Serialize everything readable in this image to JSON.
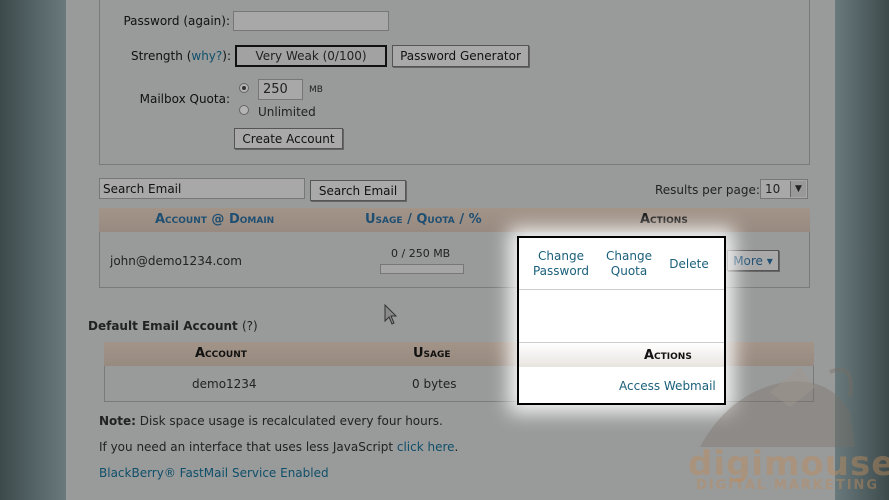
{
  "form": {
    "password_again_label": "Password (again):",
    "strength_label": "Strength",
    "strength_why": "why?",
    "strength_colon": "):",
    "strength_open": " (",
    "strength_value": "Very Weak (0/100)",
    "password_generator": "Password Generator",
    "mailbox_quota_label": "Mailbox Quota:",
    "quota_value": "250",
    "quota_unit": "MB",
    "unlimited_label": "Unlimited",
    "create_account": "Create Account"
  },
  "search": {
    "placeholder": "Search Email",
    "button": "Search Email",
    "results_label": "Results per page:",
    "results_value": "10"
  },
  "accounts_table": {
    "headers": {
      "account_domain": "Account @ Domain",
      "usage": "Usage",
      "quota": "Quota",
      "percent": "%",
      "slash": "/",
      "actions": "Actions"
    },
    "row": {
      "email": "john@demo1234.com",
      "usage": "0 / 250 MB",
      "usage_fraction": 0.0,
      "more": "More"
    }
  },
  "popup": {
    "change_password": "Change Password",
    "change_quota": "Change Quota",
    "delete": "Delete",
    "actions_header": "Actions",
    "access_webmail": "Access Webmail"
  },
  "default_account": {
    "title": "Default Email Account",
    "help": "(?)",
    "headers": {
      "account": "Account",
      "usage": "Usage"
    },
    "row": {
      "account": "demo1234",
      "usage": "0 bytes"
    }
  },
  "notes": {
    "note_bold": "Note:",
    "note_text": " Disk space usage is recalculated every four hours.",
    "js_text": "If you need an interface that uses less JavaScript ",
    "js_link": "click here",
    "js_end": ".",
    "blackberry": "BlackBerry® FastMail Service Enabled"
  },
  "watermark": {
    "brand": "digimouse",
    "tagline": "DIGITAL MARKETING"
  }
}
